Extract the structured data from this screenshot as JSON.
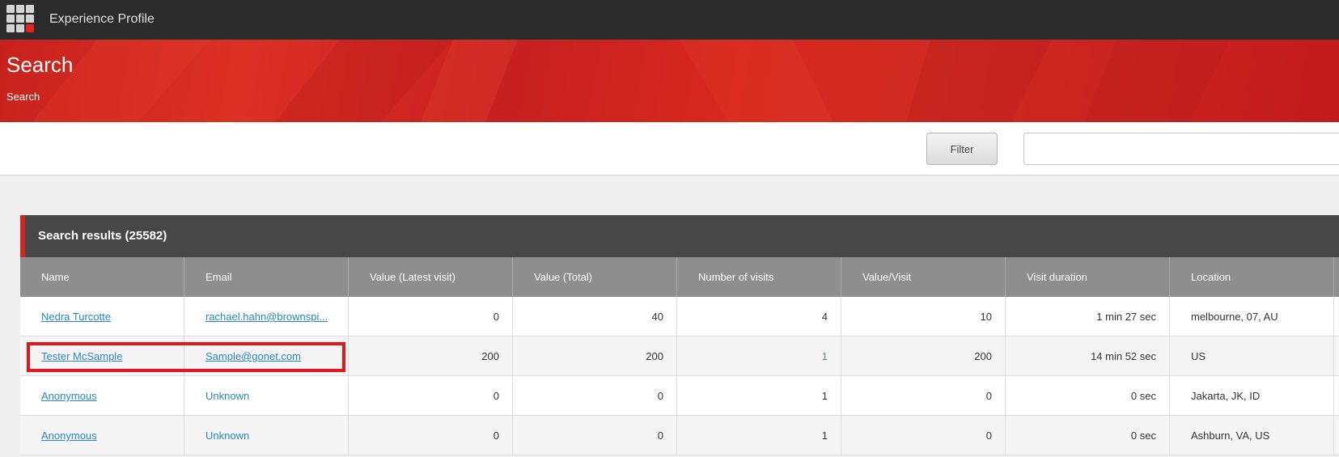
{
  "app": {
    "title": "Experience Profile"
  },
  "banner": {
    "title": "Search",
    "breadcrumb": "Search"
  },
  "toolbar": {
    "filter_label": "Filter",
    "search_value": ""
  },
  "results": {
    "title": "Search results (25582)",
    "columns": [
      "Name",
      "Email",
      "Value (Latest visit)",
      "Value (Total)",
      "Number of visits",
      "Value/Visit",
      "Visit duration",
      "Location"
    ],
    "rows": [
      {
        "name": "Nedra Turcotte",
        "email": "rachael.hahn@brownspi...",
        "value_latest": "0",
        "value_total": "40",
        "visits": "4",
        "value_per_visit": "10",
        "duration": "1 min 27 sec",
        "location": "melbourne, 07, AU"
      },
      {
        "name": "Tester McSample",
        "email": "Sample@gonet.com",
        "value_latest": "200",
        "value_total": "200",
        "visits": "1",
        "value_per_visit": "200",
        "duration": "14 min 52 sec",
        "location": "US"
      },
      {
        "name": "Anonymous",
        "email": "Unknown",
        "value_latest": "0",
        "value_total": "0",
        "visits": "1",
        "value_per_visit": "0",
        "duration": "0 sec",
        "location": "Jakarta, JK, ID"
      },
      {
        "name": "Anonymous",
        "email": "Unknown",
        "value_latest": "0",
        "value_total": "0",
        "visits": "1",
        "value_per_visit": "0",
        "duration": "0 sec",
        "location": "Ashburn, VA, US"
      }
    ]
  },
  "colors": {
    "accent": "#d3261f",
    "link": "#2a86c5",
    "highlight": "#e3161d"
  }
}
